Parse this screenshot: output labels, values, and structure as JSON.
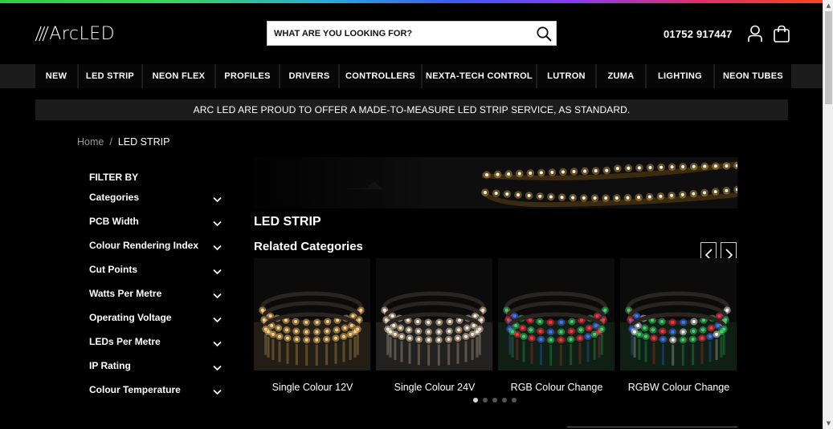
{
  "brand": {
    "logo_slashes": "///",
    "logo_text": "ArcLED"
  },
  "search": {
    "placeholder": "WHAT ARE YOU LOOKING FOR?",
    "icon": "search-icon"
  },
  "header": {
    "phone": "01752 917447",
    "account_icon": "user-icon",
    "cart_icon": "shopping-bag-icon"
  },
  "nav": {
    "items": [
      {
        "label": "NEW"
      },
      {
        "label": "LED STRIP"
      },
      {
        "label": "NEON FLEX"
      },
      {
        "label": "PROFILES"
      },
      {
        "label": "DRIVERS"
      },
      {
        "label": "CONTROLLERS"
      },
      {
        "label": "NEXTA-TECH CONTROL"
      },
      {
        "label": "LUTRON"
      },
      {
        "label": "ZUMA"
      },
      {
        "label": "LIGHTING"
      },
      {
        "label": "NEON TUBES"
      }
    ]
  },
  "announcement": "ARC LED ARE PROUD TO OFFER A MADE-TO-MEASURE LED STRIP SERVICE, AS STANDARD.",
  "breadcrumb": {
    "home": "Home",
    "separator": "/",
    "current": "LED STRIP"
  },
  "filters": {
    "title": "FILTER BY",
    "items": [
      {
        "label": "Categories"
      },
      {
        "label": "PCB Width"
      },
      {
        "label": "Colour Rendering Index"
      },
      {
        "label": "Cut Points"
      },
      {
        "label": "Watts Per Metre"
      },
      {
        "label": "Operating Voltage"
      },
      {
        "label": "LEDs Per Metre"
      },
      {
        "label": "IP Rating"
      },
      {
        "label": "Colour Temperature"
      }
    ]
  },
  "category": {
    "title": "LED STRIP",
    "related_title": "Related Categories",
    "cards": [
      {
        "label": "Single Colour 12V"
      },
      {
        "label": "Single Colour 24V"
      },
      {
        "label": "RGB Colour Change"
      },
      {
        "label": "RGBW Colour Change"
      }
    ],
    "carousel": {
      "active_dot": 1,
      "total_dots": 5
    }
  },
  "colors": {
    "background": "#000000",
    "nav_bar": "#1c1c1c",
    "warm_led": "#ffc56a",
    "accent_text": "#ffffff"
  }
}
